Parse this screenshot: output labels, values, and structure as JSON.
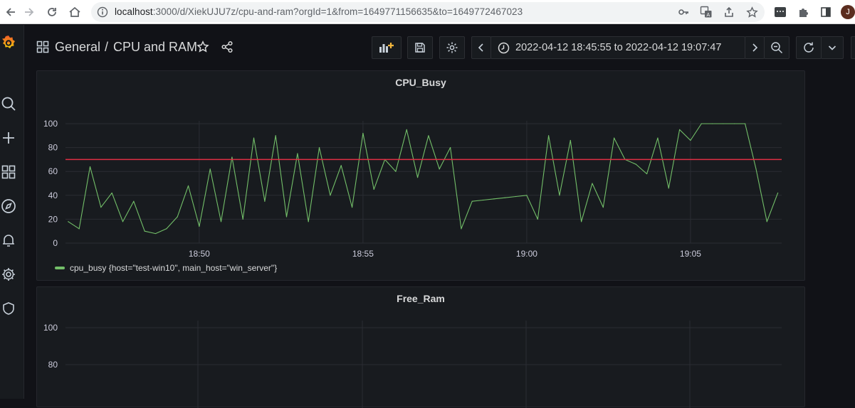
{
  "browser": {
    "url_host": "localhost",
    "url_rest": ":3000/d/XiekUJU7z/cpu-and-ram?orgId=1&from=1649771156635&to=1649772467023",
    "avatar_letter": "J"
  },
  "header": {
    "folder": "General",
    "separator": "/",
    "dashboard_title": "CPU and RAM",
    "time_range": "2022-04-12 18:45:55 to 2022-04-12 19:07:47"
  },
  "sidemenu": {
    "icons": [
      "grafana-logo-icon",
      "search-icon",
      "plus-icon",
      "dashboards-icon",
      "explore-icon",
      "alerting-icon",
      "configuration-icon",
      "shield-icon"
    ]
  },
  "panels": {
    "cpu": {
      "title": "CPU_Busy",
      "legend": "cpu_busy {host=\"test-win10\", main_host=\"win_server\"}",
      "series_color": "#73bf69",
      "threshold_color": "#e02f44"
    },
    "ram": {
      "title": "Free_Ram"
    }
  },
  "chart_data": [
    {
      "type": "line",
      "title": "CPU_Busy",
      "xlabel": "",
      "ylabel": "",
      "x_ticks": [
        "18:50",
        "18:55",
        "19:00",
        "19:05"
      ],
      "y_ticks": [
        0,
        20,
        40,
        60,
        80,
        100
      ],
      "xlim": [
        "18:45:55",
        "19:07:47"
      ],
      "ylim": [
        0,
        100
      ],
      "grid": true,
      "legend_position": "bottom-left",
      "threshold": 70,
      "series": [
        {
          "name": "cpu_busy {host=\"test-win10\", main_host=\"win_server\"}",
          "x": [
            "18:46:00",
            "18:46:20",
            "18:46:40",
            "18:47:00",
            "18:47:20",
            "18:47:40",
            "18:48:00",
            "18:48:20",
            "18:48:40",
            "18:49:00",
            "18:49:20",
            "18:49:40",
            "18:50:00",
            "18:50:20",
            "18:50:40",
            "18:51:00",
            "18:51:20",
            "18:51:40",
            "18:52:00",
            "18:52:20",
            "18:52:40",
            "18:53:00",
            "18:53:20",
            "18:53:40",
            "18:54:00",
            "18:54:20",
            "18:54:40",
            "18:55:00",
            "18:55:20",
            "18:55:40",
            "18:56:00",
            "18:56:20",
            "18:56:40",
            "18:57:00",
            "18:57:20",
            "18:57:40",
            "18:58:00",
            "18:58:20",
            "18:58:40",
            "18:59:00",
            "18:59:20",
            "18:59:40",
            "19:00:00",
            "19:00:20",
            "19:00:40",
            "19:01:00",
            "19:01:20",
            "19:01:40",
            "19:02:00",
            "19:02:20",
            "19:02:40",
            "19:03:00",
            "19:03:20",
            "19:03:40",
            "19:04:00",
            "19:04:20",
            "19:04:40",
            "19:05:00",
            "19:05:20",
            "19:05:40",
            "19:06:00",
            "19:06:20",
            "19:06:40",
            "19:07:00",
            "19:07:20",
            "19:07:40"
          ],
          "values": [
            18,
            12,
            64,
            30,
            42,
            18,
            35,
            10,
            8,
            12,
            22,
            48,
            14,
            62,
            18,
            72,
            20,
            88,
            35,
            90,
            22,
            75,
            18,
            80,
            40,
            65,
            30,
            92,
            45,
            70,
            60,
            95,
            55,
            90,
            62,
            80,
            12,
            35,
            36,
            37,
            38,
            39,
            40,
            20,
            90,
            40,
            86,
            18,
            50,
            30,
            88,
            70,
            66,
            58,
            88,
            46,
            95,
            86,
            100,
            100,
            100,
            100,
            100,
            62,
            18,
            42
          ]
        }
      ]
    },
    {
      "type": "line",
      "title": "Free_Ram",
      "x_ticks": [],
      "y_ticks": [
        80,
        100
      ],
      "grid": true,
      "series": []
    }
  ]
}
